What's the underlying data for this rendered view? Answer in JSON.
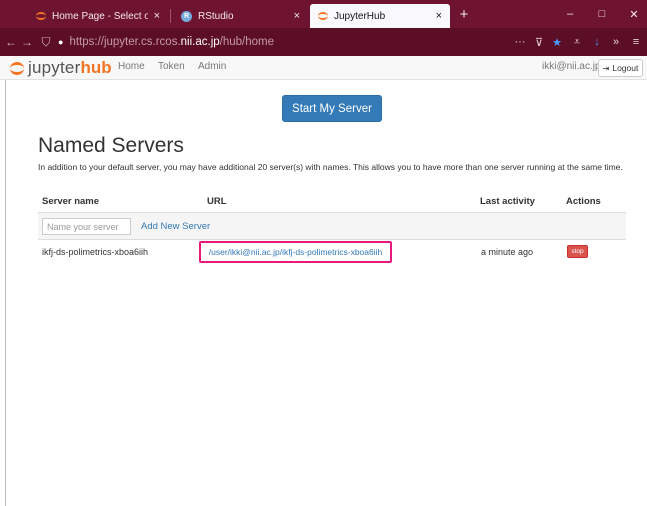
{
  "browser": {
    "tabs": [
      {
        "title": "Home Page - Select or creat",
        "close": "×",
        "icon": "jupyter-icon"
      },
      {
        "title": "RStudio",
        "close": "×",
        "icon": "rstudio-icon",
        "icon_letter": "R"
      },
      {
        "title": "JupyterHub",
        "close": "×",
        "icon": "jupyter-icon"
      }
    ],
    "new_tab": "+",
    "window_controls": {
      "minimize": "–",
      "maximize": "□",
      "close": "✕"
    },
    "nav": {
      "back": "←",
      "forward": "→"
    },
    "address": {
      "shield": "⛉",
      "lock": "🔒",
      "scheme": "https://jupyter.cs.rcos.",
      "host": "nii.ac.jp",
      "path": "/hub/home"
    },
    "toolbar": {
      "more": "···",
      "pocket": "⊽",
      "bookmark": "★",
      "library": "⩡",
      "download": "↓",
      "overflow": "»",
      "menu": "≡"
    },
    "colors": {
      "frame": "#6e1431",
      "urlbar": "#5b0e25",
      "accent": "#f37524",
      "link": "#337ab7",
      "highlight": "#e8197a",
      "danger": "#d9534f"
    }
  },
  "navbar": {
    "brand_jupyter": "jupyter",
    "brand_hub": "hub",
    "links": {
      "home": "Home",
      "token": "Token",
      "admin": "Admin"
    },
    "user": "ikki@nii.ac.jp",
    "logout": "Logout",
    "logout_icon": "⇥"
  },
  "main": {
    "start_button": "Start My Server",
    "title": "Named Servers",
    "description": "In addition to your default server, you may have additional 20 server(s) with names. This allows you to have more than one server running at the same time.",
    "columns": {
      "name": "Server name",
      "url": "URL",
      "activity": "Last activity",
      "actions": "Actions"
    },
    "new_server": {
      "placeholder": "Name your server",
      "add_label": "Add New Server"
    },
    "servers": [
      {
        "name": "ikfj-ds-polimetrics-xboa6iih",
        "url": "/user/ikki@nii.ac.jp/ikfj-ds-polimetrics-xboa6iih",
        "last_activity": "a minute ago",
        "action": "stop"
      }
    ]
  }
}
